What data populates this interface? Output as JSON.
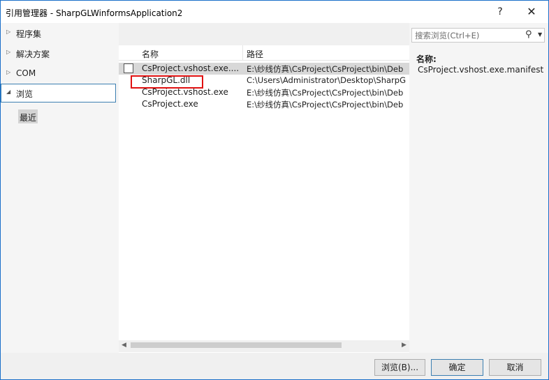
{
  "window": {
    "title": "引用管理器 - SharpGLWinformsApplication2",
    "help_label": "?",
    "close_label": "✕"
  },
  "sidebar": {
    "items": [
      {
        "label": "程序集",
        "arrow": "▷",
        "expanded": false
      },
      {
        "label": "解决方案",
        "arrow": "▷",
        "expanded": false
      },
      {
        "label": "COM",
        "arrow": "▷",
        "expanded": false
      },
      {
        "label": "浏览",
        "arrow": "◢",
        "expanded": true,
        "selected": true
      }
    ],
    "sub_item": "最近"
  },
  "list": {
    "columns": {
      "name": "名称",
      "path": "路径"
    },
    "rows": [
      {
        "name": "CsProject.vshost.exe....",
        "path": "E:\\纱线仿真\\CsProject\\CsProject\\bin\\Deb",
        "checkbox": true,
        "checked": false,
        "selected": true
      },
      {
        "name": "SharpGL.dll",
        "path": "C:\\Users\\Administrator\\Desktop\\SharpG",
        "checkbox": false
      },
      {
        "name": "CsProject.vshost.exe",
        "path": "E:\\纱线仿真\\CsProject\\CsProject\\bin\\Deb",
        "checkbox": false
      },
      {
        "name": "CsProject.exe",
        "path": "E:\\纱线仿真\\CsProject\\CsProject\\bin\\Deb",
        "checkbox": false
      }
    ],
    "highlight_color": "#e01010"
  },
  "search": {
    "placeholder": "搜索浏览(Ctrl+E)",
    "icon": "search-icon"
  },
  "details": {
    "name_label": "名称:",
    "name_value": "CsProject.vshost.exe.manifest"
  },
  "footer": {
    "browse_label": "浏览(B)...",
    "ok_label": "确定",
    "cancel_label": "取消"
  },
  "colors": {
    "accent": "#3c7fb1",
    "selected_row": "#d8d8d8",
    "window_border": "#1a6fc9"
  }
}
